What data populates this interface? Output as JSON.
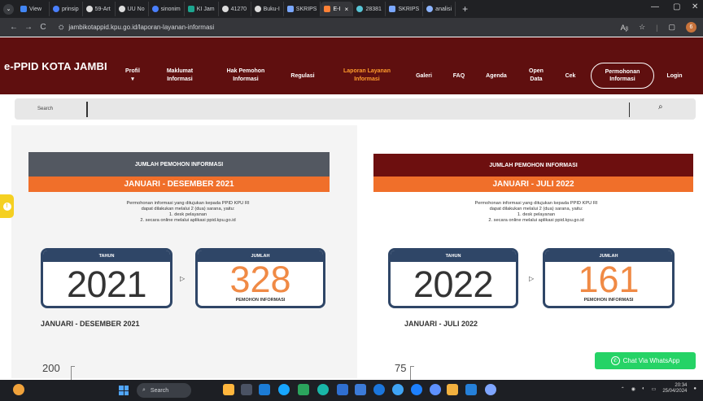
{
  "browser": {
    "tabs": [
      {
        "label": "View"
      },
      {
        "label": "prinsip"
      },
      {
        "label": "59-Art"
      },
      {
        "label": "UU No"
      },
      {
        "label": "sinonim"
      },
      {
        "label": "KI Jam"
      },
      {
        "label": "41270"
      },
      {
        "label": "Buku-I"
      },
      {
        "label": "SKRIPS"
      },
      {
        "label": "E-I",
        "close": "×"
      },
      {
        "label": "28381"
      },
      {
        "label": "SKRIPS"
      },
      {
        "label": "analisi"
      }
    ],
    "new_tab": "+",
    "window_controls": {
      "minimize": "—",
      "maximize": "▢",
      "close": "✕"
    },
    "url": "jambikotappid.kpu.go.id/laporan-layanan-informasi",
    "nav": {
      "back": "←",
      "forward": "→",
      "reload": "C"
    },
    "tools": {
      "translate": "Aᵦ",
      "favorite": "☆",
      "profile": "6"
    }
  },
  "site": {
    "brand": "e-PPID KOTA JAMBI",
    "nav": {
      "profil": "Profil",
      "profil_dropdown": "▾",
      "maklumat": "Maklumat\nInformasi",
      "hak": "Hak Pemohon\nInformasi",
      "regulasi": "Regulasi",
      "laporan": "Laporan Layanan\nInformasi",
      "galeri": "Galeri",
      "faq": "FAQ",
      "agenda": "Agenda",
      "open_data": "Open\nData",
      "cek": "Cek",
      "permohonan": "Permohonan\nInformasi",
      "login": "Login"
    },
    "search": {
      "label": "Search",
      "icon": "⌕"
    }
  },
  "cards": {
    "left": {
      "title": "JUMLAH PEMOHON INFORMASI",
      "period": "JANUARI - DESEMBER 2021",
      "description": "Permohonan informasi yang ditujukan kepada PPID KPU RI\ndapat dilakukan melalui 2 (dua) sarana, yaitu:\n1. desk pelayanan\n2. secara online melalui aplikasi ppid.kpu.go.id",
      "tahun_label": "TAHUN",
      "year": "2021",
      "jumlah_label": "JUMLAH",
      "count": "328",
      "count_caption": "PEMOHON INFORMASI",
      "footer_period": "JANUARI - DESEMBER 2021",
      "axis_value": "200"
    },
    "right": {
      "title": "JUMLAH PEMOHON INFORMASI",
      "period": "JANUARI - JULI 2022",
      "description": "Permohonan informasi yang ditujukan kepada PPID KPU RI\ndapat dilakukan melalui 2 (dua) sarana, yaitu:\n1. desk pelayanan\n2. secara online melalui aplikasi ppid.kpu.go.id",
      "tahun_label": "TAHUN",
      "year": "2022",
      "jumlah_label": "JUMLAH",
      "count": "161",
      "count_caption": "PEMOHON INFORMASI",
      "footer_period": "JANUARI - JULI 2022",
      "axis_value": "75"
    }
  },
  "floating": {
    "whatsapp": "Chat Via WhatsApp",
    "left_tool": "!"
  },
  "taskbar": {
    "search": "Search",
    "time": "20:34",
    "date": "25/04/2024"
  },
  "colors": {
    "site_nav": "#5f0f0f",
    "active_nav": "#ff9b2c",
    "orange": "#f06f2a",
    "navy": "#2f4667",
    "whatsapp": "#25d366"
  }
}
